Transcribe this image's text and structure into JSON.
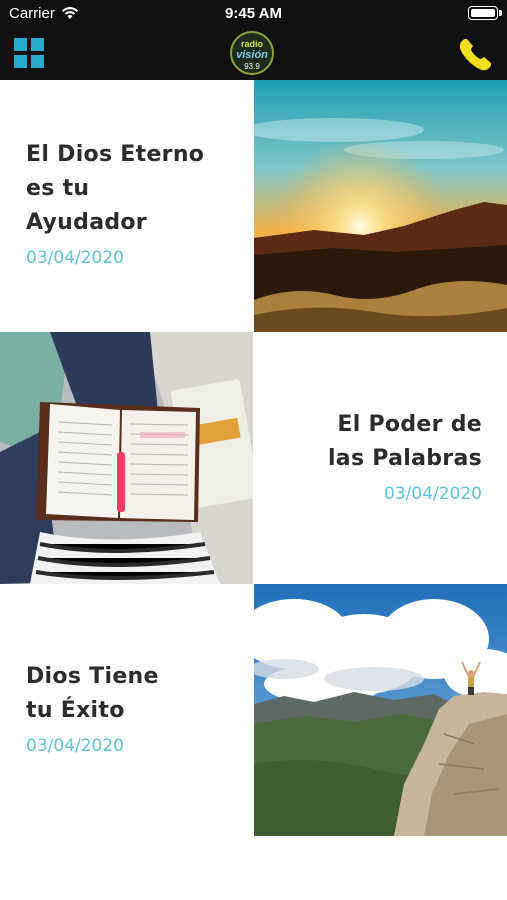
{
  "status_bar": {
    "carrier": "Carrier",
    "time": "9:45 AM"
  },
  "nav": {
    "logo_top": "radio",
    "logo_main": "visión",
    "logo_freq": "93.9",
    "left_icon": "grid-menu-icon",
    "right_icon": "phone-icon",
    "accent_color": "#29a9cc",
    "phone_color": "#f3df1f"
  },
  "articles": [
    {
      "title_lines": [
        "El Dios Eterno",
        "es tu",
        "Ayudador"
      ],
      "date": "03/04/2020",
      "image": "sunset-over-hills"
    },
    {
      "title_lines": [
        "El Poder de",
        "las Palabras"
      ],
      "date": "03/04/2020",
      "image": "open-bible-on-lap"
    },
    {
      "title_lines": [
        "Dios Tiene",
        "tu Éxito"
      ],
      "date": "03/04/2020",
      "image": "hiker-on-mountain-cliff"
    }
  ],
  "date_color": "#5ec2d6"
}
